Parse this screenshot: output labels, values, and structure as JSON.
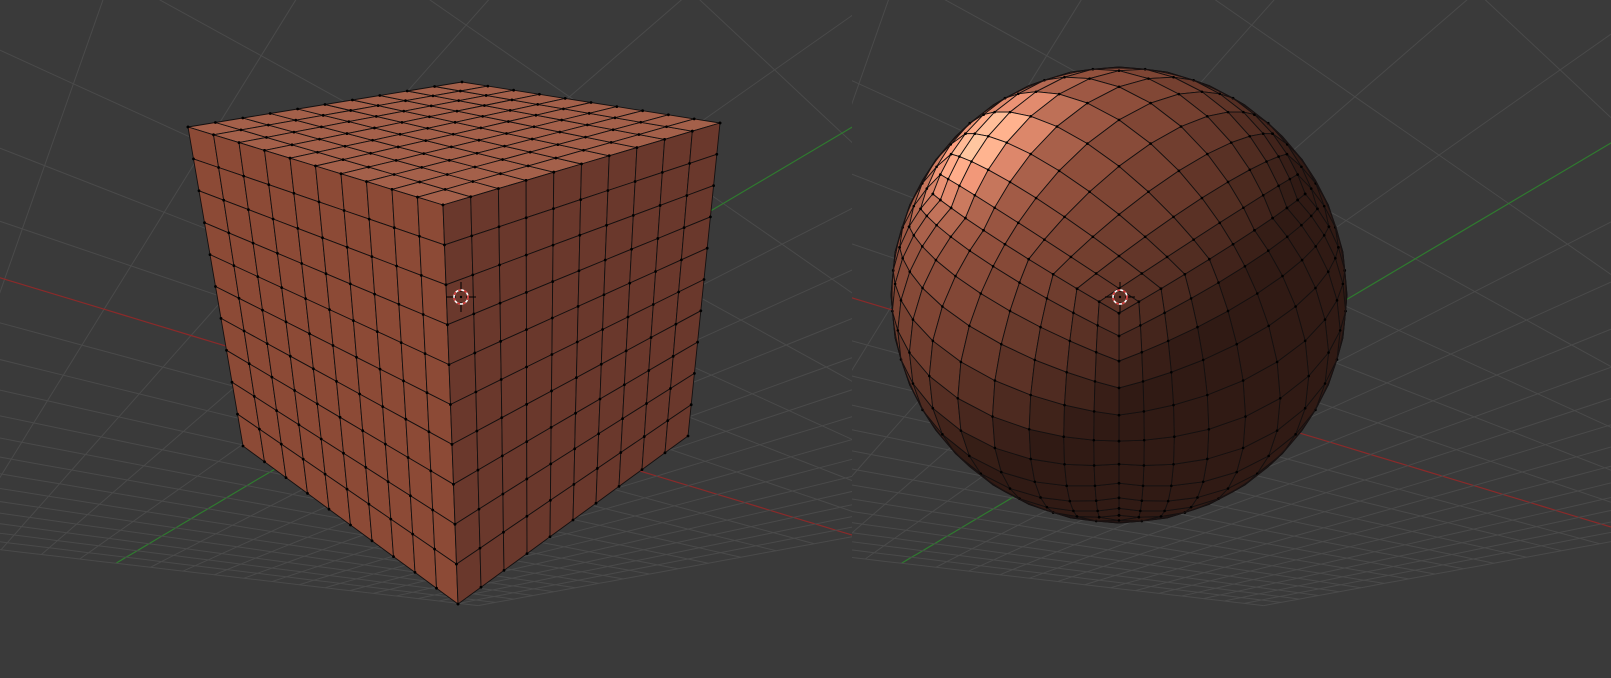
{
  "scene": {
    "viewports": [
      {
        "id": "left",
        "object": {
          "type": "cube-mesh",
          "subdivisions": 10
        },
        "cursor": {
          "name": "3d-cursor-icon"
        }
      },
      {
        "id": "right",
        "object": {
          "type": "quad-sphere-mesh",
          "subdivisions": 10
        },
        "cursor": {
          "name": "3d-cursor-icon"
        }
      }
    ],
    "colors": {
      "background": "#3a3a3a",
      "grid_line": "#4a4a4a",
      "x_axis": "#8a2a2a",
      "y_axis": "#2f7a2f",
      "mesh_top": "#a4604a",
      "mesh_left": "#8c4a36",
      "mesh_right": "#6a382c",
      "wire": "#141010",
      "vertex": "#000000",
      "cursor_ring": "#d03030",
      "cursor_ring_alt": "#ffffff"
    }
  }
}
